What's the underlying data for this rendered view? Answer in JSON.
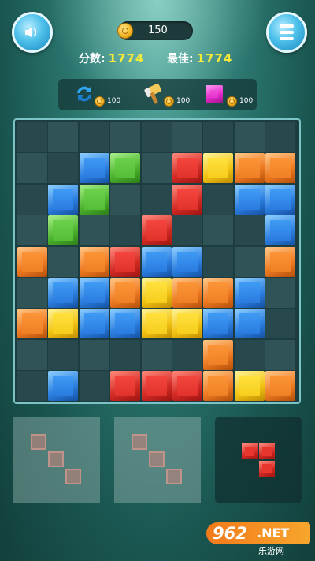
{
  "header": {
    "coins": "150",
    "score_label": "分数:",
    "score_value": "1774",
    "best_label": "最佳:",
    "best_value": "1774"
  },
  "icons": {
    "sound": "speaker-icon",
    "menu": "menu-icon",
    "coin": "coin-icon"
  },
  "powerups": [
    {
      "name": "refresh",
      "icon": "refresh-icon",
      "cost": "100"
    },
    {
      "name": "hammer",
      "icon": "hammer-icon",
      "cost": "100"
    },
    {
      "name": "single-block",
      "icon": "block-icon",
      "cost": "100"
    }
  ],
  "board": {
    "rows": 9,
    "cols": 9,
    "grid": [
      [
        "",
        "",
        "",
        "",
        "",
        "",
        "",
        "",
        ""
      ],
      [
        "",
        "",
        "blue",
        "green",
        "",
        "red",
        "yellow",
        "orange",
        "orange"
      ],
      [
        "",
        "blue",
        "green",
        "",
        "",
        "red",
        "",
        "blue",
        "blue"
      ],
      [
        "",
        "green",
        "",
        "",
        "red",
        "",
        "",
        "",
        "blue"
      ],
      [
        "orange",
        "",
        "orange",
        "red",
        "blue",
        "blue",
        "",
        "",
        "orange"
      ],
      [
        "",
        "blue",
        "blue",
        "orange",
        "yellow",
        "orange",
        "orange",
        "blue",
        ""
      ],
      [
        "orange",
        "yellow",
        "blue",
        "blue",
        "yellow",
        "yellow",
        "blue",
        "blue",
        ""
      ],
      [
        "",
        "",
        "",
        "",
        "",
        "",
        "orange",
        "",
        ""
      ],
      [
        "",
        "blue",
        "",
        "red",
        "red",
        "red",
        "orange",
        "yellow",
        "orange"
      ]
    ]
  },
  "trays": [
    {
      "style": "light",
      "color": "red",
      "active": false,
      "cells": [
        [
          0,
          0
        ],
        [
          1,
          1
        ],
        [
          2,
          2
        ]
      ]
    },
    {
      "style": "light",
      "color": "red",
      "active": false,
      "cells": [
        [
          0,
          0
        ],
        [
          1,
          1
        ],
        [
          2,
          2
        ]
      ]
    },
    {
      "style": "dark",
      "color": "red",
      "active": true,
      "cells": [
        [
          0,
          0
        ],
        [
          0,
          1
        ],
        [
          1,
          1
        ]
      ]
    }
  ],
  "colors": {
    "red": "#e0322b",
    "blue": "#2a7be0",
    "green": "#55bd36",
    "orange": "#ef7f25",
    "yellow": "#f6cd1c",
    "magenta": "#e432cb",
    "score_value": "#f5ea3a"
  },
  "watermark": {
    "number": "962",
    "suffix": ".NET",
    "sub": "乐游网"
  }
}
